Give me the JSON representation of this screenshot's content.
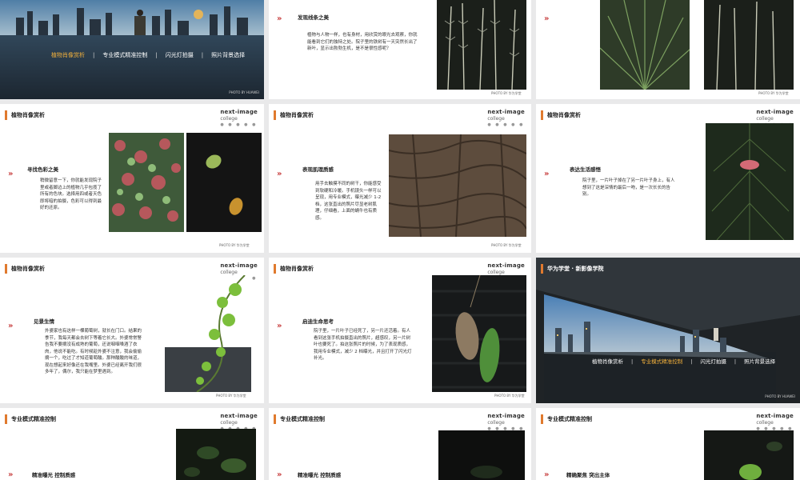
{
  "nav": {
    "items": [
      "植物肖像赏析",
      "专业模式精准控制",
      "闪光灯拍摄",
      "照片背景选择"
    ],
    "separator": "|",
    "credit": "PHOTO BY HUAWEI"
  },
  "cover2_title": "华为学堂 · 新影像学院",
  "logo": {
    "line1": "next-image",
    "line2": "college",
    "dots": "● ● ● ● ●"
  },
  "credit_photo": "PHOTO BY 华为学堂",
  "section_plants": "植物肖像赏析",
  "section_pro": "专业模式精准控制",
  "slides": {
    "lines": {
      "heading": "发现线条之美",
      "body": "植物与人物一样，也有身材，用欣赏的眼光去观察，你就能看到它们的独特之处。院子里的铁树有一天突然长出了新叶，显示出勃勃生机，是不是很性感呢？"
    },
    "color": {
      "heading": "寻找色彩之美",
      "body": "稍微留意一下，你就能发现院子里或者脚边上的植物几乎包揽了所有的色块。选择用四或者天色即将暗的拍摄，色彩可以得到最好的还原。"
    },
    "texture": {
      "heading": "表现肌理质感",
      "body": "用手去触摸不同的树干，你能感受到软硬和冷暖。手机镜头一样可以呈现，用专业模式，曝光减少 1-2 档，这张直出的照片尽显老树肌理，仔细看，上面的蜗牛也有质感。"
    },
    "emotion": {
      "heading": "表达生活感悟",
      "body": "院子里，一片叶子掉在了另一片叶子身上，有人想到了这是深情的最后一吻，是一次长长的告别。"
    },
    "life": {
      "heading": "见景生情",
      "body": "外婆家也有这样一棵葡萄树，就长在门口。结果的季节，我每天都会去树下等着它长大。外婆常常警告我不要摘没有成熟的葡萄，还说咽咽嗓酒了衣肉，他说不能吃。有时候趁外婆不注意，我会偷偷摘一个，吃过了才知道葡萄酸。那种酸酸的味道，现在想起来好像还在我嘴里。外婆已经离开我们很多年了，偶尔，我只能在梦里遇到。"
    },
    "think": {
      "heading": "启迪生命思考",
      "body": "院子里，一片叶子已经死了，另一片还活着。有人看到这张手机拍摄直出的照片，超感叹，另一片树叶也要死了。拍这张照片的时候，为了表现质感，我用专业模式，减少 2 档曝光，并且打开了闪光灯补光。"
    },
    "pro1": {
      "heading": "精准曝光 控制质感"
    },
    "pro2": {
      "heading": "精准曝光 控制质感"
    },
    "pro3": {
      "heading": "精确聚焦 突出主体"
    }
  }
}
